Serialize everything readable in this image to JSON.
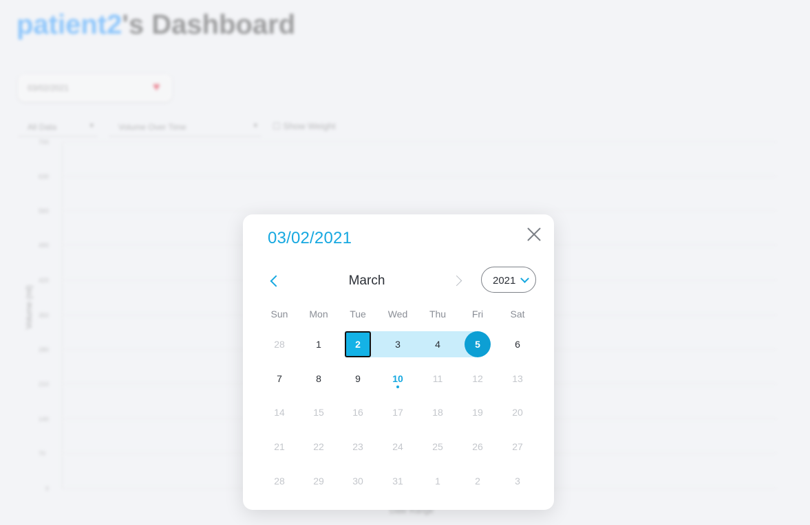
{
  "dashboard": {
    "title_user": "patient2",
    "title_suffix": "'s Dashboard",
    "date_box_value": "03/02/2021",
    "select_1": "All Data",
    "select_2": "Volume Over Time",
    "show_weight_label": "Show Weight",
    "y_axis_label": "Volume (ml)",
    "x_axis_label": "Date Range",
    "y_ticks": [
      "700",
      "630",
      "560",
      "490",
      "420",
      "350",
      "280",
      "210",
      "140",
      "70",
      "0"
    ]
  },
  "datepicker": {
    "selected_date": "03/02/2021",
    "month": "March",
    "year": "2021",
    "weekdays": [
      "Sun",
      "Mon",
      "Tue",
      "Wed",
      "Thu",
      "Fri",
      "Sat"
    ],
    "weeks": [
      [
        {
          "d": "28",
          "s": "muted"
        },
        {
          "d": "1",
          "s": ""
        },
        {
          "d": "2",
          "s": "range-start"
        },
        {
          "d": "3",
          "s": "in-range"
        },
        {
          "d": "4",
          "s": "in-range"
        },
        {
          "d": "5",
          "s": "range-end"
        },
        {
          "d": "6",
          "s": ""
        }
      ],
      [
        {
          "d": "7",
          "s": ""
        },
        {
          "d": "8",
          "s": ""
        },
        {
          "d": "9",
          "s": ""
        },
        {
          "d": "10",
          "s": "today"
        },
        {
          "d": "11",
          "s": "muted"
        },
        {
          "d": "12",
          "s": "muted"
        },
        {
          "d": "13",
          "s": "muted"
        }
      ],
      [
        {
          "d": "14",
          "s": "muted"
        },
        {
          "d": "15",
          "s": "muted"
        },
        {
          "d": "16",
          "s": "muted"
        },
        {
          "d": "17",
          "s": "muted"
        },
        {
          "d": "18",
          "s": "muted"
        },
        {
          "d": "19",
          "s": "muted"
        },
        {
          "d": "20",
          "s": "muted"
        }
      ],
      [
        {
          "d": "21",
          "s": "muted"
        },
        {
          "d": "22",
          "s": "muted"
        },
        {
          "d": "23",
          "s": "muted"
        },
        {
          "d": "24",
          "s": "muted"
        },
        {
          "d": "25",
          "s": "muted"
        },
        {
          "d": "26",
          "s": "muted"
        },
        {
          "d": "27",
          "s": "muted"
        }
      ],
      [
        {
          "d": "28",
          "s": "muted"
        },
        {
          "d": "29",
          "s": "muted"
        },
        {
          "d": "30",
          "s": "muted"
        },
        {
          "d": "31",
          "s": "muted"
        },
        {
          "d": "1",
          "s": "muted"
        },
        {
          "d": "2",
          "s": "muted"
        },
        {
          "d": "3",
          "s": "muted"
        }
      ]
    ],
    "colors": {
      "accent": "#16a8e0",
      "range_fill": "#c9edfb",
      "range_end": "#0d9fd4"
    }
  }
}
